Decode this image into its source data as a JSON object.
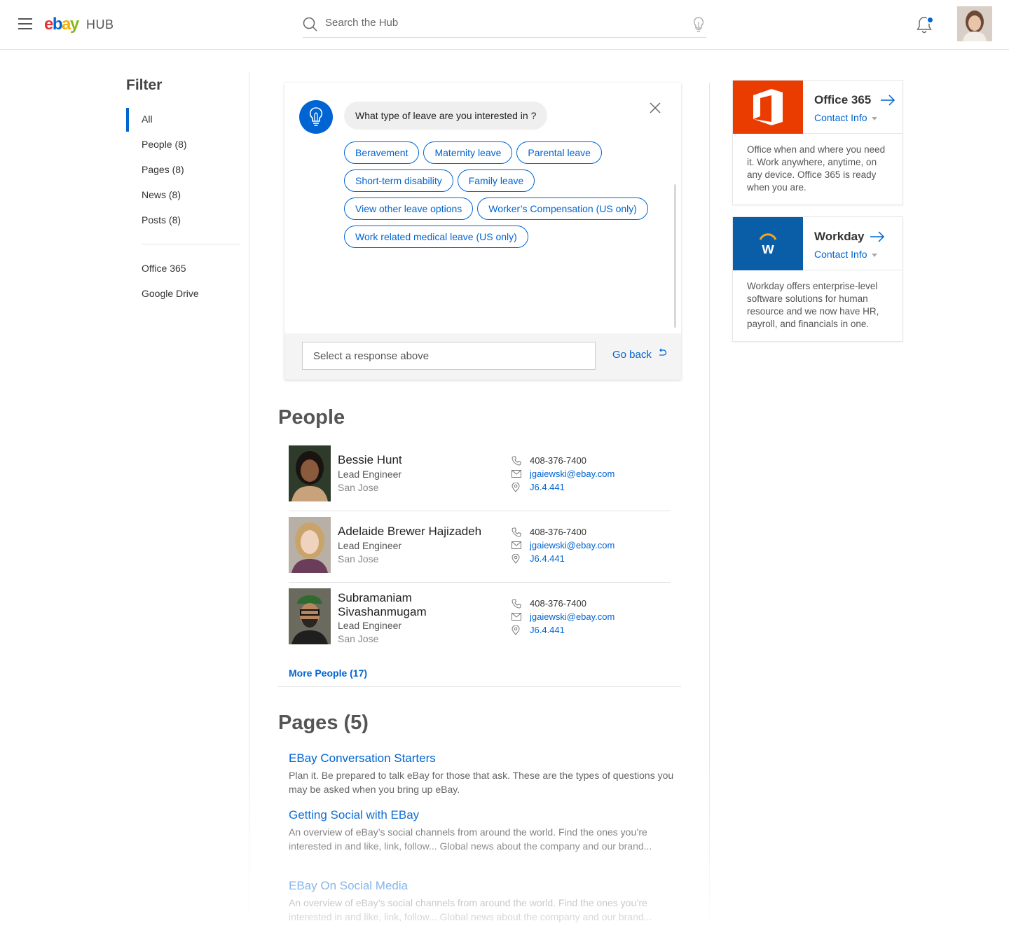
{
  "header": {
    "logo_hub": "HUB",
    "search_placeholder": "Search the Hub",
    "notification_dot_color": "#0064d2"
  },
  "sidebar": {
    "title": "Filter",
    "items": [
      {
        "label": "All",
        "active": true
      },
      {
        "label": "People (8)"
      },
      {
        "label": "Pages (8)"
      },
      {
        "label": "News (8)"
      },
      {
        "label": "Posts (8)"
      }
    ],
    "sources": [
      {
        "label": "Office 365"
      },
      {
        "label": "Google Drive"
      }
    ]
  },
  "chat": {
    "question": "What type of leave are you interested in ?",
    "chip_rows": [
      [
        "Beravement",
        "Maternity leave",
        "Parental leave"
      ],
      [
        "Short-term disability",
        "Family leave"
      ],
      [
        "View other leave options",
        "Worker’s Compensation (US only)"
      ],
      [
        "Work related medical leave (US only)"
      ]
    ],
    "input_placeholder": "Select a response above",
    "go_back": "Go back"
  },
  "people_section": {
    "title": "People",
    "people": [
      {
        "name": "Bessie Hunt",
        "role": "Lead Engineer",
        "location": "San Jose",
        "phone": "408-376-7400",
        "email": "jgaiewski@ebay.com",
        "office": "J6.4.441"
      },
      {
        "name": "Adelaide Brewer Hajizadeh",
        "role": "Lead Engineer",
        "location": "San Jose",
        "phone": "408-376-7400",
        "email": "jgaiewski@ebay.com",
        "office": "J6.4.441"
      },
      {
        "name": "Subramaniam Sivashanmugam",
        "role": "Lead Engineer",
        "location": "San Jose",
        "phone": "408-376-7400",
        "email": "jgaiewski@ebay.com",
        "office": "J6.4.441"
      }
    ],
    "more_link": "More People (17)"
  },
  "pages_section": {
    "title": "Pages (5)",
    "pages": [
      {
        "title": "EBay Conversation Starters",
        "desc": "Plan it. Be prepared to talk eBay for those that ask. These are the types of questions you may be asked when you bring up eBay."
      },
      {
        "title": "Getting Social with EBay",
        "desc": "An overview of eBay’s social channels from around the world. Find the ones you’re interested in and like, link, follow... Global news about the company and our brand..."
      },
      {
        "title": "EBay On Social Media",
        "desc": "An overview of eBay’s social channels from around the world. Find the ones you’re interested in and like, link, follow... Global news about the company and our brand..."
      }
    ]
  },
  "apps": [
    {
      "name": "Office 365",
      "contact": "Contact Info",
      "logo_color": "#eb3c00",
      "desc": "Office when and where you need it. Work anywhere, anytime, on any device. Office 365 is ready when you are."
    },
    {
      "name": "Workday",
      "contact": "Contact Info",
      "logo_color": "#0a5ea8",
      "desc": "Workday offers enterprise-level software solutions for human resource and  we now have HR, payroll, and financials in one."
    }
  ]
}
